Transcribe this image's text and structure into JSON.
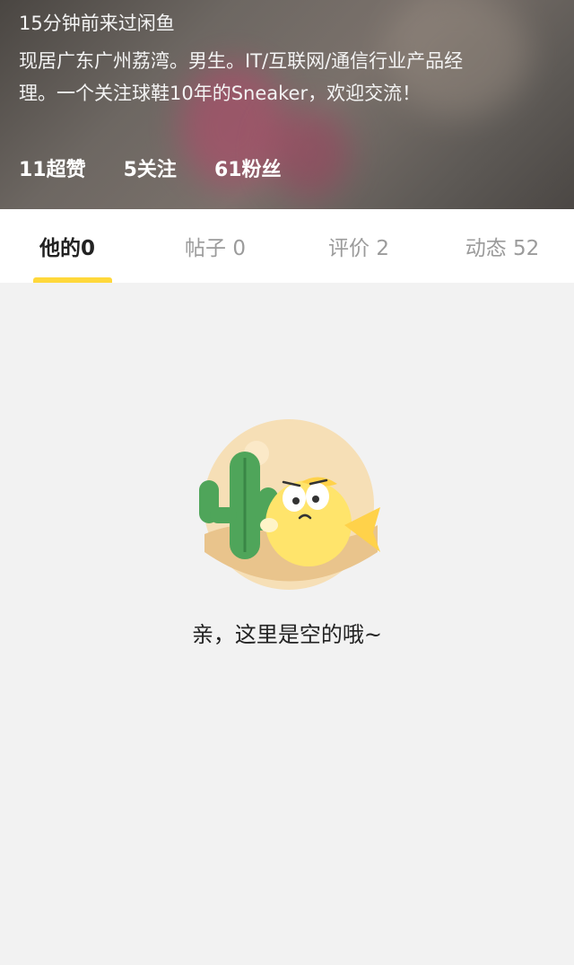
{
  "profile": {
    "last_seen": "15分钟前来过闲鱼",
    "bio_line1": "现居广东广州荔湾。男生。IT/互联网/通信行业产品经",
    "bio_line2": "理。一个关注球鞋10年的Sneaker，欢迎交流！",
    "stats": [
      {
        "label": "11超赞"
      },
      {
        "label": "5关注"
      },
      {
        "label": "61粉丝"
      }
    ]
  },
  "tabs": [
    {
      "label": "他的0",
      "active": true
    },
    {
      "label": "帖子 0",
      "active": false
    },
    {
      "label": "评价 2",
      "active": false
    },
    {
      "label": "动态 52",
      "active": false
    }
  ],
  "empty_state": {
    "message": "亲，这里是空的哦~",
    "icons": [
      "cactus-icon",
      "fish-mascot-icon"
    ]
  },
  "colors": {
    "accent": "#ffd83b",
    "background": "#f2f2f2",
    "tab_inactive": "#9b9b9b",
    "text_primary": "#222222"
  }
}
